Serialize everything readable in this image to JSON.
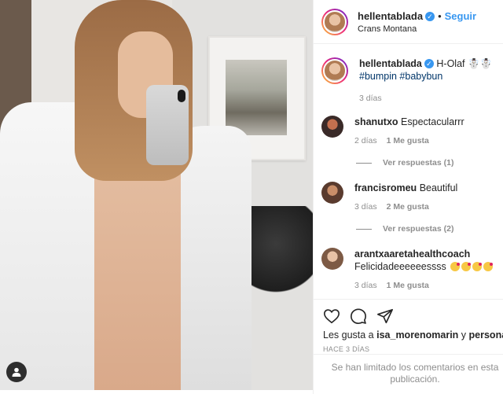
{
  "header": {
    "username": "hellentablada",
    "verified_mark": "✓",
    "separator": "•",
    "follow_label": "Seguir",
    "location": "Crans Montana"
  },
  "caption": {
    "username": "hellentablada",
    "text": "H-Olaf ☃️☃️",
    "hashtags": "#bumpin #babybun",
    "time": "3 días"
  },
  "comments": [
    {
      "username": "shanutxo",
      "text": "Espectacularrr",
      "time": "2 días",
      "likes": "1 Me gusta",
      "replies": "Ver respuestas (1)"
    },
    {
      "username": "francisromeu",
      "text": "Beautiful",
      "time": "3 días",
      "likes": "2 Me gusta",
      "replies": "Ver respuestas (2)"
    },
    {
      "username": "arantxaaretahealthcoach",
      "text": "Felicidadeeeeeessss",
      "time": "3 días",
      "likes": "1 Me gusta"
    }
  ],
  "actions": {
    "like_icon": "heart-icon",
    "comment_icon": "comment-icon",
    "share_icon": "share-icon"
  },
  "likes": {
    "prefix": "Les gusta a ",
    "user": "isa_morenomarin",
    "middle": " y ",
    "others": "personas m"
  },
  "timestamp": "HACE 3 DÍAS",
  "comments_limited": "Se han limitado los comentarios en esta publicación.",
  "colors": {
    "accent": "#3897f0",
    "muted": "#8e8e8e",
    "text": "#262626"
  }
}
